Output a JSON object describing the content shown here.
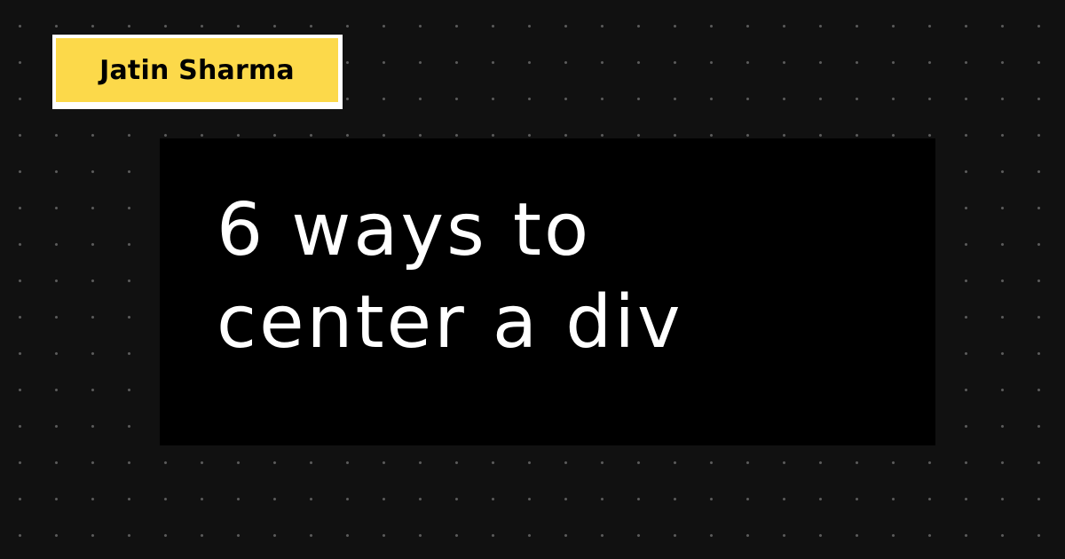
{
  "author": {
    "name": "Jatin Sharma"
  },
  "card": {
    "title_lines": [
      "6 ways to",
      "center a div"
    ]
  },
  "colors": {
    "background": "#111111",
    "dot": "#5a5a5a",
    "tag_fill": "#fcd94a",
    "tag_border": "#ffffff",
    "card": "#000000",
    "title_text": "#ffffff"
  }
}
